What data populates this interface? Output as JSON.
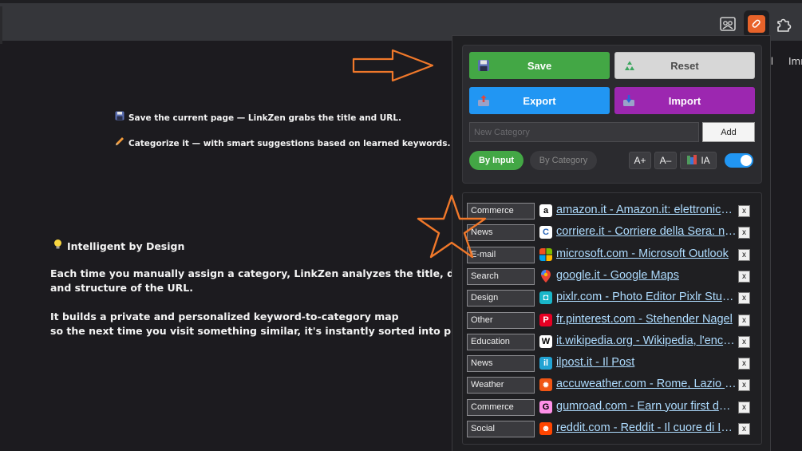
{
  "toolbar": {
    "icons": [
      "frame-icon",
      "linkzen-extension-icon",
      "puzzle-icon"
    ],
    "cut_text": "ail",
    "cut_text2": "Imm"
  },
  "page": {
    "line1_icon": "floppy-disk-icon",
    "line1": "Save the current page — LinkZen grabs the title and URL.",
    "line2_icon": "pencil-icon",
    "line2": "Categorize it — with smart suggestions based on learned keywords.",
    "heading_icon": "lightbulb-icon",
    "heading": "Intelligent by Design",
    "para1a": "Each time you manually assign a category, LinkZen analyzes the title, domain",
    "para1b": "and structure of the URL.",
    "para2a": "It builds a private and personalized keyword-to-category map",
    "para2b": "so the next time you visit something similar, it's instantly sorted into place."
  },
  "popup": {
    "save_label": "Save",
    "reset_label": "Reset",
    "export_label": "Export",
    "import_label": "Import",
    "new_category_placeholder": "New Category",
    "add_label": "Add",
    "by_input_label": "By Input",
    "by_category_label": "By Category",
    "font_increase_label": "A+",
    "font_decrease_label": "A–",
    "ia_label": "IA",
    "ia_toggle_on": true,
    "remove_label": "x",
    "links": [
      {
        "category": "Commerce",
        "text": "amazon.it - Amazon.it: elettronica, libri, musica, fashion",
        "favicon": "amazon-icon"
      },
      {
        "category": "News",
        "text": "corriere.it - Corriere della Sera: news e ultime notizie",
        "favicon": "corriere-icon"
      },
      {
        "category": "E-mail",
        "text": "microsoft.com - Microsoft Outlook",
        "favicon": "microsoft-icon"
      },
      {
        "category": "Search",
        "text": "google.it - Google Maps",
        "favicon": "google-maps-icon"
      },
      {
        "category": "Design",
        "text": "pixlr.com - Photo Editor Pixlr Studio",
        "favicon": "pixlr-icon"
      },
      {
        "category": "Other",
        "text": "fr.pinterest.com - Stehender Nagel",
        "favicon": "pinterest-icon"
      },
      {
        "category": "Education",
        "text": "it.wikipedia.org - Wikipedia, l'enciclopedia libera",
        "favicon": "wikipedia-icon"
      },
      {
        "category": "News",
        "text": "ilpost.it - Il Post",
        "favicon": "ilpost-icon"
      },
      {
        "category": "Weather",
        "text": "accuweather.com - Rome, Lazio Weather",
        "favicon": "accuweather-icon"
      },
      {
        "category": "Commerce",
        "text": "gumroad.com - Earn your first dollar",
        "favicon": "gumroad-icon"
      },
      {
        "category": "Social",
        "text": "reddit.com - Reddit - Il cuore di Internet",
        "favicon": "reddit-icon"
      }
    ]
  },
  "colors": {
    "save": "#43a745",
    "reset": "#d7d7d7",
    "export": "#2196f3",
    "import": "#9c27b0",
    "annotation": "#f0782a",
    "link": "#aedcff"
  }
}
